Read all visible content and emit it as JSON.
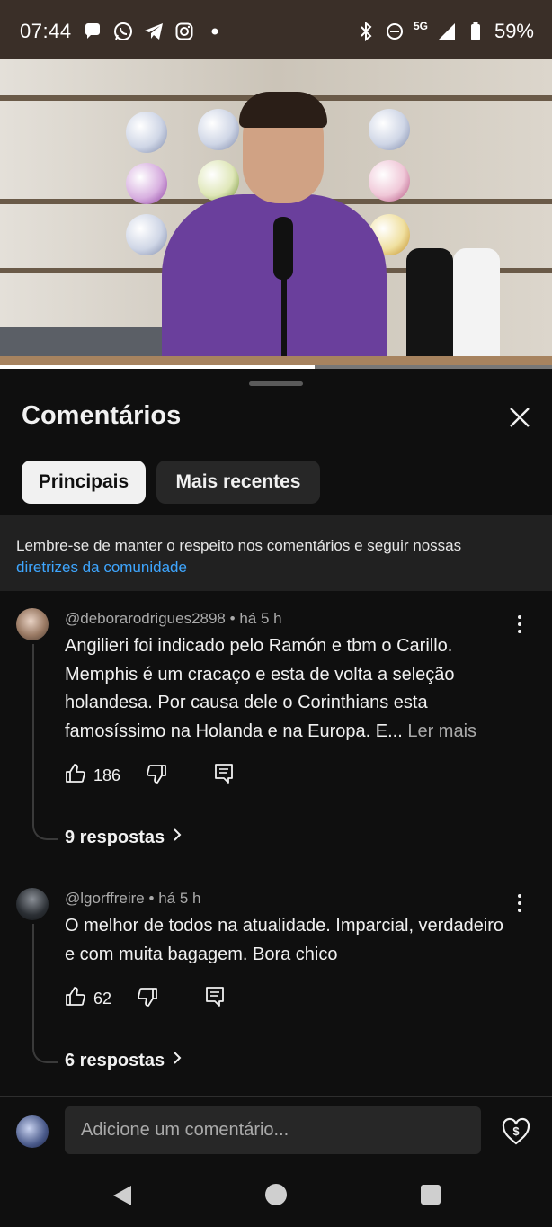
{
  "status_bar": {
    "time": "07:44",
    "network": "5G",
    "battery": "59%",
    "left_icons": [
      "chat-bubble-icon",
      "whatsapp-icon",
      "telegram-icon",
      "instagram-icon",
      "dot-icon"
    ],
    "right_icons": [
      "bluetooth-icon",
      "dnd-icon",
      "signal-icon",
      "battery-icon"
    ]
  },
  "video": {
    "progress": 0.57
  },
  "comments_panel": {
    "title": "Comentários",
    "chips": {
      "top": "Principais",
      "newest": "Mais recentes"
    },
    "notice": {
      "text": "Lembre-se de manter o respeito nos comentários e seguir nossas",
      "link": "diretrizes da comunidade"
    },
    "comments": [
      {
        "author": "@deborarodrigues2898",
        "time": "há 5 h",
        "text": "Angilieri foi indicado pelo Ramón e tbm o Carillo. Memphis é um cracaço e esta de volta a seleção holandesa. Por causa dele o Corinthians  esta famosíssimo na Holanda e na Europa. E...",
        "read_more": "Ler mais",
        "likes": "186",
        "replies": "9 respostas"
      },
      {
        "author": "@lgorffreire",
        "time": "há 5 h",
        "text": "O melhor de todos na atualidade. Imparcial, verdadeiro e com muita bagagem. Bora chico",
        "likes": "62",
        "replies": "6 respostas"
      }
    ],
    "composer": {
      "placeholder": "Adicione um comentário..."
    }
  },
  "colors": {
    "background": "#0f0f0f",
    "link": "#3ea6ff",
    "chip_active": "#f1f1f1",
    "chip_inactive": "#272727"
  }
}
